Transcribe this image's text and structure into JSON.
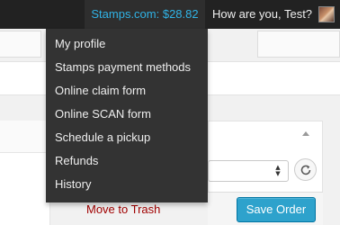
{
  "admin_bar": {
    "balance_label": "Stamps.com: $28.82",
    "greeting": "How are you, Test?"
  },
  "account_menu": {
    "items": [
      {
        "label": "My profile"
      },
      {
        "label": "Stamps payment methods"
      },
      {
        "label": "Online claim form"
      },
      {
        "label": "Online SCAN form"
      },
      {
        "label": "Schedule a pickup"
      },
      {
        "label": "Refunds"
      },
      {
        "label": "History"
      }
    ]
  },
  "order_actions": {
    "trash_label": "Move to Trash",
    "save_label": "Save Order",
    "action_select_value": ""
  },
  "colors": {
    "admin_bar_bg": "#222222",
    "menu_bg": "#333333",
    "balance_text": "#30b3e6",
    "save_button_bg": "#2ea2cc",
    "trash_link": "#a00000"
  },
  "icons": [
    "user-avatar",
    "collapse-arrow-icon",
    "select-arrows-icon",
    "refresh-icon"
  ]
}
